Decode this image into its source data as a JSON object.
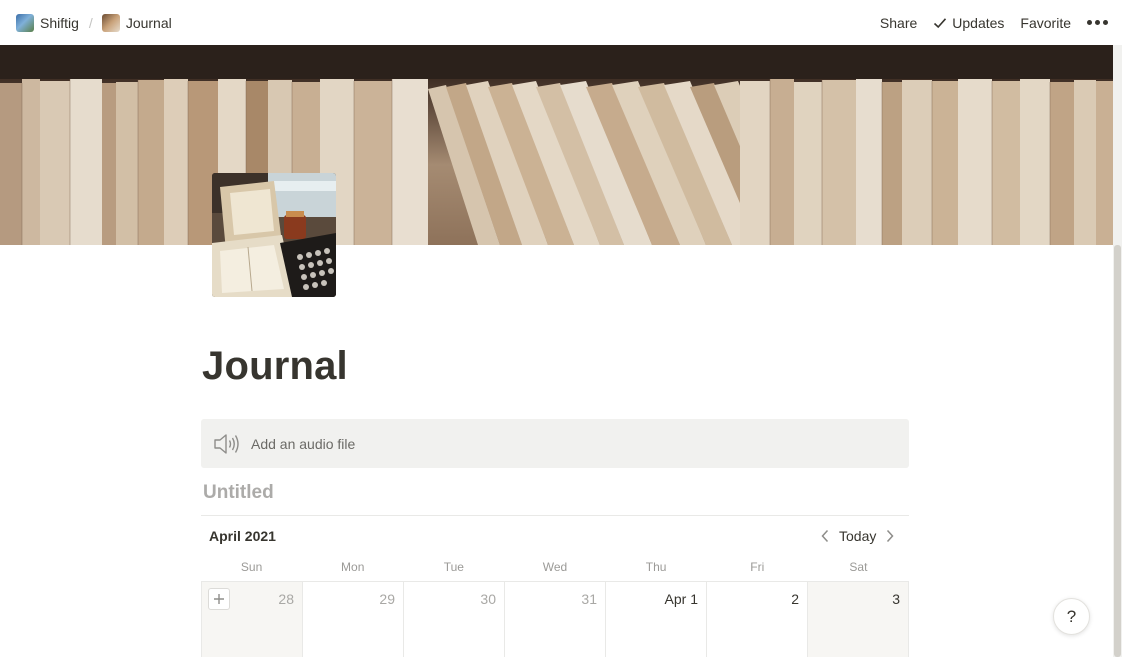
{
  "topbar": {
    "breadcrumbs": [
      {
        "label": "Shiftig",
        "icon": "workspace-photo-icon"
      },
      {
        "label": "Journal",
        "icon": "journal-photo-icon"
      }
    ],
    "separator": "/",
    "share_label": "Share",
    "updates_label": "Updates",
    "favorite_label": "Favorite",
    "more_icon": "more-horizontal-icon"
  },
  "page": {
    "title": "Journal",
    "cover": "bookshelf-photo",
    "icon": "typewriter-photo"
  },
  "audio_block": {
    "label": "Add an audio file",
    "icon": "speaker-icon"
  },
  "database": {
    "title": "Untitled",
    "month_label": "April 2021",
    "today_label": "Today",
    "weekdays": [
      "Sun",
      "Mon",
      "Tue",
      "Wed",
      "Thu",
      "Fri",
      "Sat"
    ],
    "first_week": [
      {
        "label": "28",
        "current_month": false,
        "weekend": true
      },
      {
        "label": "29",
        "current_month": false,
        "weekend": false
      },
      {
        "label": "30",
        "current_month": false,
        "weekend": false
      },
      {
        "label": "31",
        "current_month": false,
        "weekend": false
      },
      {
        "label": "Apr 1",
        "current_month": true,
        "weekend": false
      },
      {
        "label": "2",
        "current_month": true,
        "weekend": false
      },
      {
        "label": "3",
        "current_month": true,
        "weekend": true
      }
    ]
  },
  "help_label": "?",
  "colors": {
    "text": "#37352f",
    "muted": "#9b9a97",
    "block_bg": "#f1f1ef",
    "weekend_bg": "#f7f6f3",
    "border": "#e9e9e7"
  }
}
